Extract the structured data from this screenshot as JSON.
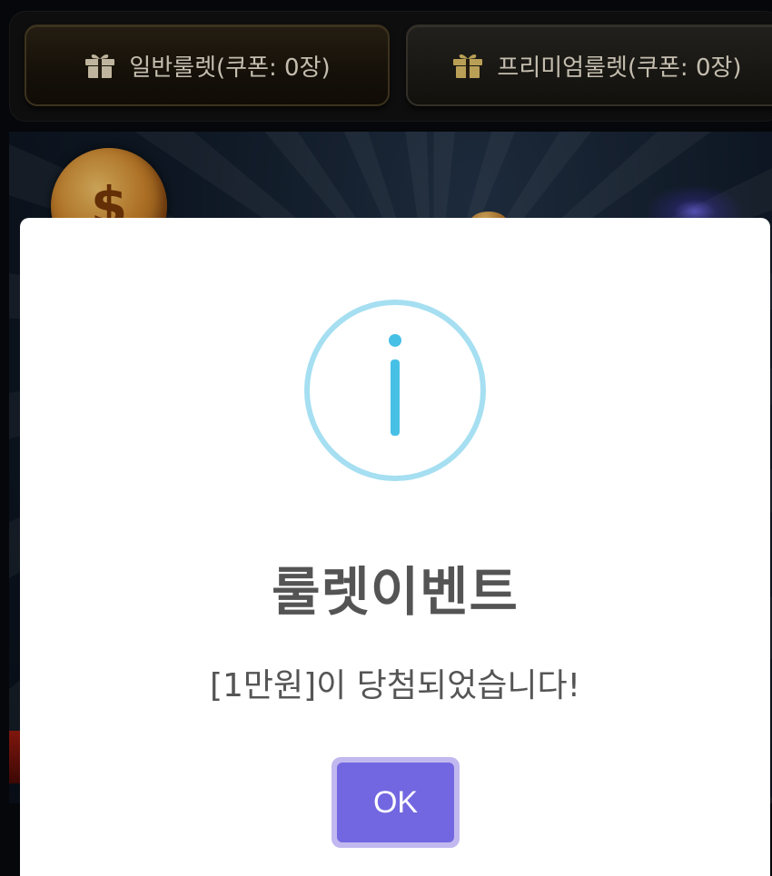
{
  "tabs": [
    {
      "label": "일반룰렛(쿠폰: 0장)",
      "icon": "gift-icon"
    },
    {
      "label": "프리미엄룰렛(쿠폰: 0장)",
      "icon": "gift-icon"
    }
  ],
  "background": {
    "coin_symbol": "$"
  },
  "modal": {
    "icon": "info-icon",
    "title": "룰렛이벤트",
    "message": "[1만원]이 당첨되었습니다!",
    "ok_label": "OK"
  },
  "colors": {
    "info_ring": "#a5dff1",
    "info_glyph": "#47c0e6",
    "ok_button": "#7267e0",
    "tab_gold_border": "#4a3d24"
  }
}
